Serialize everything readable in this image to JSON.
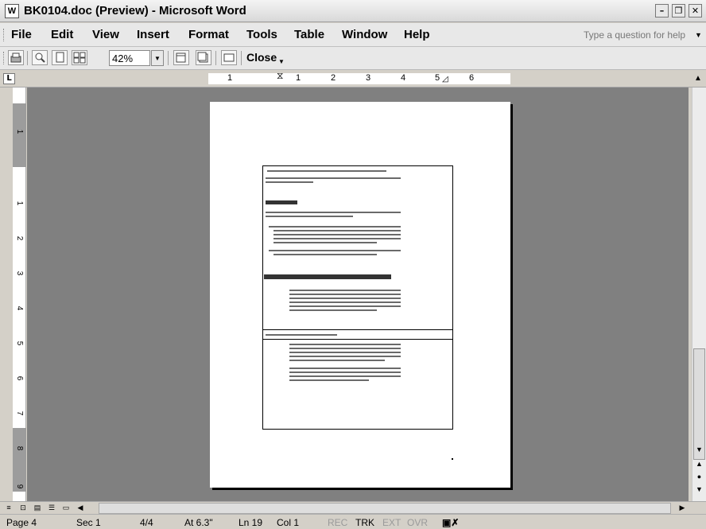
{
  "window": {
    "title": "BK0104.doc (Preview) - Microsoft Word",
    "app_icon": "W"
  },
  "menu": {
    "items": [
      "File",
      "Edit",
      "View",
      "Insert",
      "Format",
      "Tools",
      "Table",
      "Window",
      "Help"
    ],
    "help_placeholder": "Type a question for help"
  },
  "toolbar": {
    "zoom": "42%",
    "close_label": "Close"
  },
  "ruler": {
    "tab_selector": "L",
    "h_numbers": [
      "1",
      "1",
      "2",
      "3",
      "4",
      "5",
      "6"
    ],
    "v_numbers": [
      "1",
      "1",
      "2",
      "3",
      "4",
      "5",
      "6",
      "7",
      "8",
      "9"
    ]
  },
  "status": {
    "page": "Page 4",
    "sec": "Sec 1",
    "pages": "4/4",
    "at": "At 6.3\"",
    "ln": "Ln 19",
    "col": "Col 1",
    "rec": "REC",
    "trk": "TRK",
    "ext": "EXT",
    "ovr": "OVR"
  },
  "colors": {
    "workspace": "#808080",
    "chrome": "#d4d0c8",
    "page": "#ffffff"
  }
}
